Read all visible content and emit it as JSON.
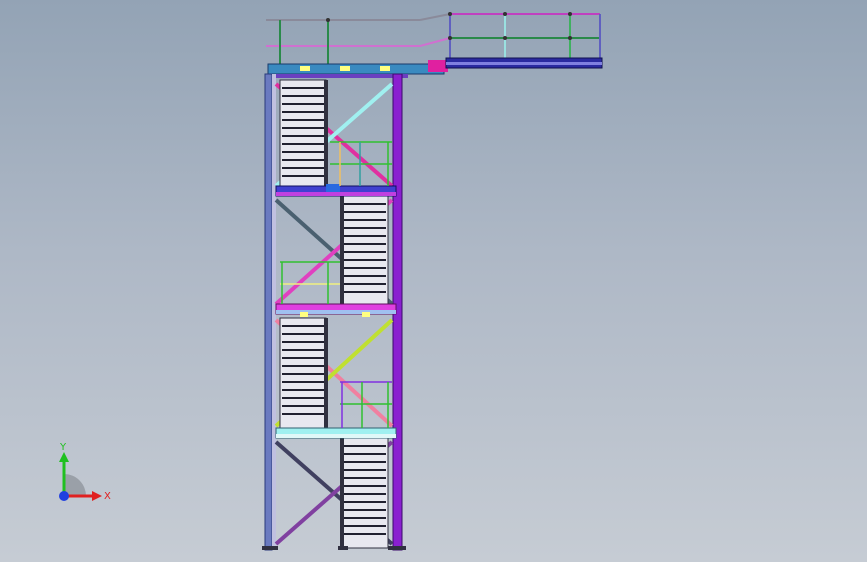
{
  "viewport": {
    "background_top": "#93a3b5",
    "background_bottom": "#c6ccd4"
  },
  "triad": {
    "x_label": "X",
    "y_label": "Y",
    "x_color": "#e02020",
    "y_color": "#20c020",
    "z_color": "#2040e0"
  },
  "model": {
    "name": "stair-tower",
    "flights": 4,
    "landings": 4
  }
}
